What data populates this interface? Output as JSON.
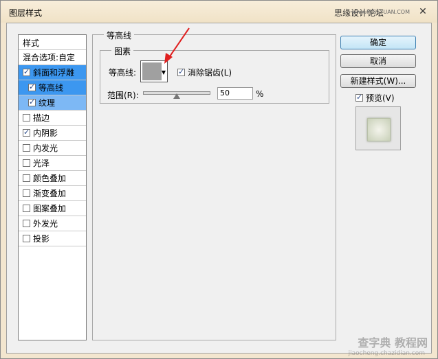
{
  "window": {
    "title": "图层样式",
    "watermark_top": "思缘设计论坛",
    "watermark_top_url": "www.MISSYUAN.COM",
    "close_label": "✕"
  },
  "styles_panel": {
    "header": "样式",
    "blend_options": "混合选项:自定",
    "items": [
      {
        "label": "斜面和浮雕",
        "checked": true
      },
      {
        "label": "等高线",
        "checked": true
      },
      {
        "label": "纹理",
        "checked": true
      },
      {
        "label": "描边",
        "checked": false
      },
      {
        "label": "内阴影",
        "checked": true
      },
      {
        "label": "内发光",
        "checked": false
      },
      {
        "label": "光泽",
        "checked": false
      },
      {
        "label": "颜色叠加",
        "checked": false
      },
      {
        "label": "渐变叠加",
        "checked": false
      },
      {
        "label": "图案叠加",
        "checked": false
      },
      {
        "label": "外发光",
        "checked": false
      },
      {
        "label": "投影",
        "checked": false
      }
    ]
  },
  "main": {
    "group_title": "等高线",
    "elements_title": "图素",
    "contour_label": "等高线:",
    "antialias_label": "消除锯齿(L)",
    "antialias_checked": true,
    "range_label": "范围(R):",
    "range_value": "50",
    "range_unit": "%",
    "range_percent": 50
  },
  "buttons": {
    "ok": "确定",
    "cancel": "取消",
    "new_style": "新建样式(W)...",
    "preview_label": "预览(V)",
    "preview_checked": true
  },
  "watermark_bottom": {
    "text": "查字典 教程网",
    "url": "jiaocheng.chazidian.com"
  },
  "colors": {
    "selection": "#3c97f0",
    "sub_selection": "#7db8f5",
    "annotation_arrow": "#e02020"
  }
}
